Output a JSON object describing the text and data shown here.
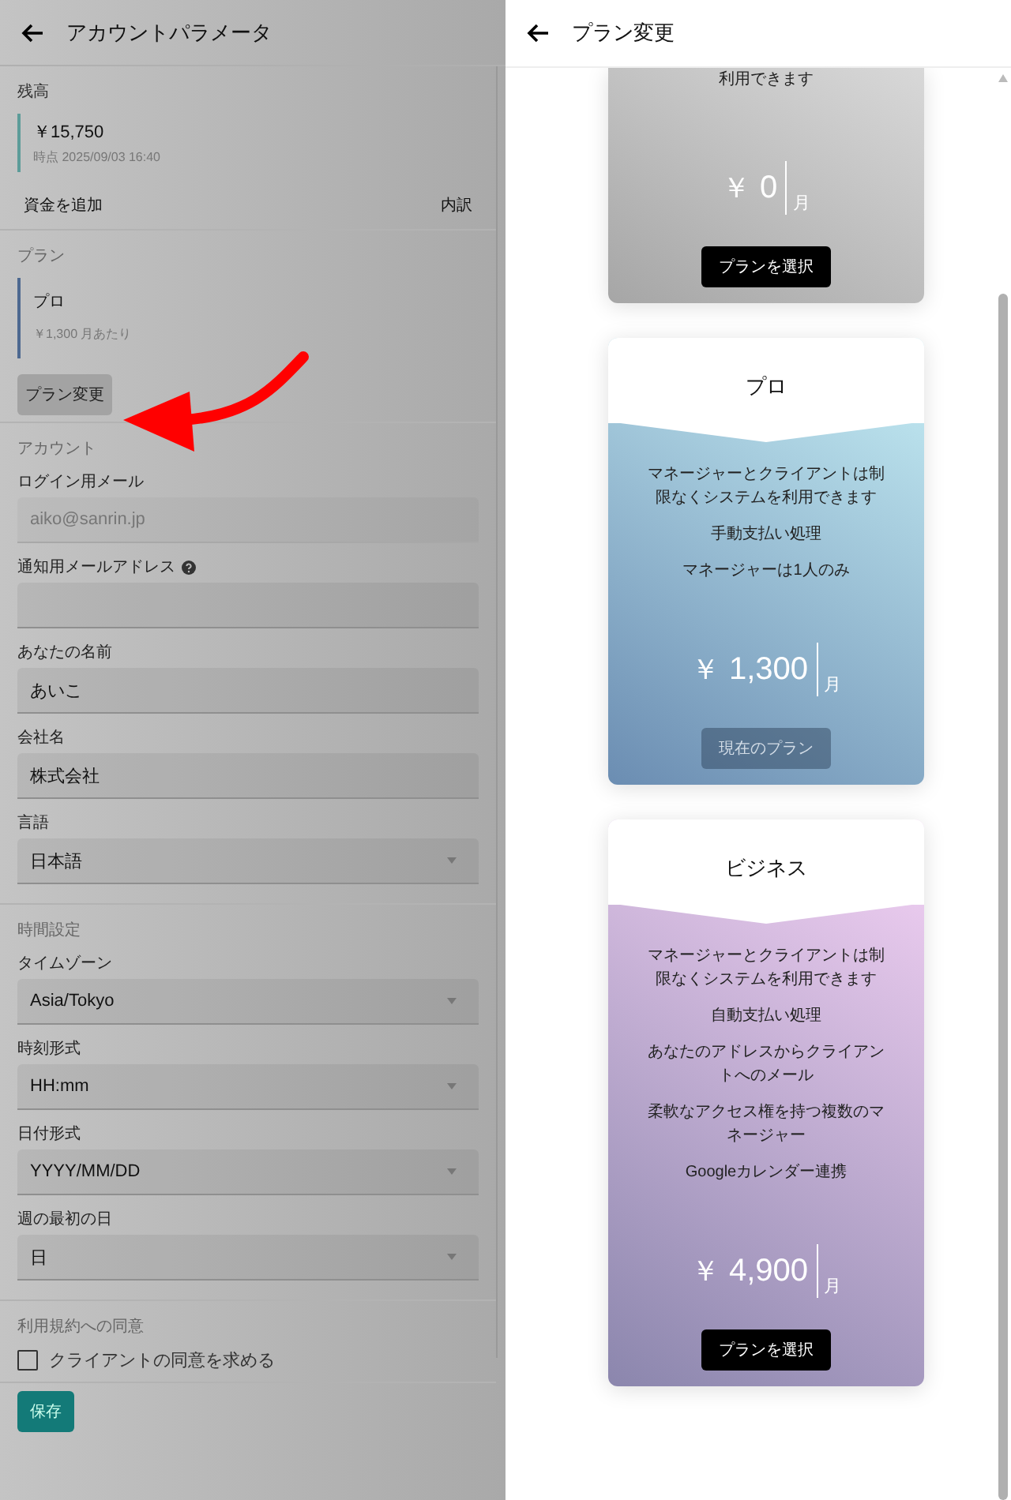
{
  "account_page": {
    "title": "アカウントパラメータ",
    "balance": {
      "heading": "残高",
      "amount": "￥15,750",
      "as_of": "時点 2025/09/03 16:40",
      "add_funds": "資金を追加",
      "breakdown": "内訳"
    },
    "plan": {
      "heading": "プラン",
      "name": "プロ",
      "price": "￥1,300 月あたり",
      "change_button": "プラン変更"
    },
    "sections": [
      {
        "heading": "アカウント",
        "fields": [
          {
            "label": "ログイン用メール",
            "kind": "text",
            "value": "aiko@sanrin.jp",
            "disabled": true,
            "help": false
          },
          {
            "label": "通知用メールアドレス",
            "kind": "text",
            "disabled": false,
            "help": true
          },
          {
            "label": "あなたの名前",
            "kind": "text",
            "value": "あいこ",
            "disabled": false,
            "help": false
          },
          {
            "label": "会社名",
            "kind": "text",
            "value": "株式会社",
            "disabled": false,
            "help": false
          },
          {
            "label": "言語",
            "kind": "select",
            "value": "日本語",
            "disabled": false,
            "help": false
          }
        ]
      },
      {
        "heading": "時間設定",
        "fields": [
          {
            "label": "タイムゾーン",
            "kind": "select",
            "value": "Asia/Tokyo",
            "disabled": false,
            "help": false
          },
          {
            "label": "時刻形式",
            "kind": "select",
            "value": "HH:mm",
            "disabled": false,
            "help": false
          },
          {
            "label": "日付形式",
            "kind": "select",
            "value": "YYYY/MM/DD",
            "disabled": false,
            "help": false
          },
          {
            "label": "週の最初の日",
            "kind": "select",
            "value": "日",
            "disabled": false,
            "help": false
          }
        ]
      }
    ],
    "terms": {
      "heading": "利用規約への同意",
      "checkbox": {
        "label": "クライアントの同意を求める",
        "checked": false
      }
    },
    "save_button": "保存"
  },
  "plan_drawer": {
    "title": "プラン変更",
    "plans": [
      {
        "kind": "grey",
        "features": [
          "利用できます"
        ],
        "currency": "￥",
        "price": "0",
        "unit": "月",
        "button": "プランを選択",
        "current": false
      },
      {
        "kind": "blue",
        "name": "プロ",
        "features": [
          "マネージャーとクライアントは制限なくシステムを利用できます",
          "手動支払い処理",
          "マネージャーは1人のみ"
        ],
        "currency": "￥",
        "price": "1,300",
        "unit": "月",
        "button": "現在のプラン",
        "current": true
      },
      {
        "kind": "purple",
        "name": "ビジネス",
        "features": [
          "マネージャーとクライアントは制限なくシステムを利用できます",
          "自動支払い処理",
          "あなたのアドレスからクライアントへのメール",
          "柔軟なアクセス権を持つ複数のマネージャー",
          "Googleカレンダー連携"
        ],
        "currency": "￥",
        "price": "4,900",
        "unit": "月",
        "button": "プランを選択",
        "current": false
      }
    ]
  }
}
